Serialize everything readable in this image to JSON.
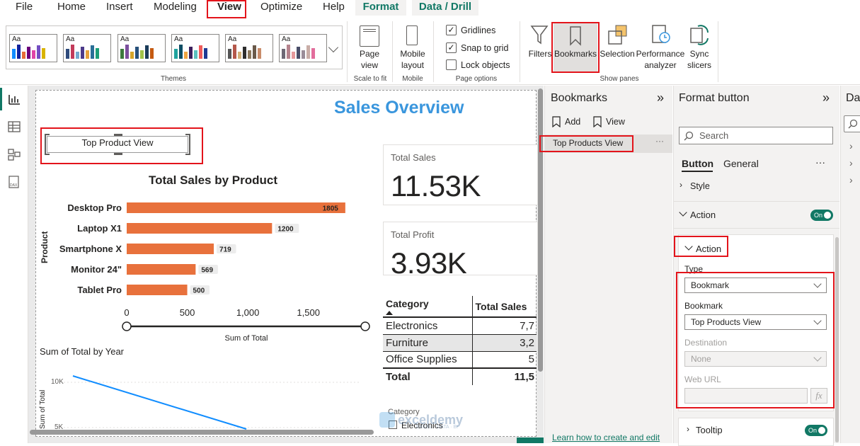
{
  "menu": {
    "items": [
      "File",
      "Home",
      "Insert",
      "Modeling",
      "View",
      "Optimize",
      "Help"
    ],
    "contextual": [
      "Format",
      "Data / Drill"
    ],
    "active": "View"
  },
  "ribbon": {
    "themes_label": "Themes",
    "page_view": {
      "label1": "Page",
      "label2": "view",
      "group": "Scale to fit"
    },
    "mobile": {
      "label1": "Mobile",
      "label2": "layout",
      "group": "Mobile"
    },
    "page_options": {
      "gridlines": "Gridlines",
      "snap": "Snap to grid",
      "lock": "Lock objects",
      "group": "Page options",
      "gridlines_checked": true,
      "snap_checked": true,
      "lock_checked": false
    },
    "show_panes": {
      "filters": "Filters",
      "bookmarks": "Bookmarks",
      "selection": "Selection",
      "perf1": "Performance",
      "perf2": "analyzer",
      "sync1": "Sync",
      "sync2": "slicers",
      "group": "Show panes"
    }
  },
  "report": {
    "title": "Sales Overview",
    "button_text": "Top Product View",
    "bar_chart": {
      "title": "Total Sales by Product",
      "ylabel": "Product",
      "xlabel": "Sum of Total",
      "xticks": [
        "0",
        "500",
        "1,000",
        "1,500"
      ]
    },
    "cards": [
      {
        "label": "Total Sales",
        "value": "11.53K"
      },
      {
        "label": "Total Profit",
        "value": "3.93K"
      }
    ],
    "matrix": {
      "headers": [
        "Category",
        "Total Sales"
      ],
      "rows": [
        {
          "cat": "Electronics",
          "val": "7,7"
        },
        {
          "cat": "Furniture",
          "val": "3,2"
        },
        {
          "cat": "Office Supplies",
          "val": "5"
        }
      ],
      "total_label": "Total",
      "total_val": "11,5"
    },
    "line_chart": {
      "title": "Sum of Total by Year",
      "ylabel": "Sum of Total",
      "yticks": [
        "10K",
        "5K"
      ]
    },
    "slicer": {
      "title": "Category",
      "item": "Electronics"
    },
    "watermark": {
      "name": "exceldemy",
      "tagline": "EXCEL · DATA · BI"
    }
  },
  "chart_data": {
    "type": "bar",
    "title": "Total Sales by Product",
    "categories": [
      "Desktop Pro",
      "Laptop X1",
      "Smartphone X",
      "Monitor 24\"",
      "Tablet Pro"
    ],
    "values": [
      1805,
      1200,
      719,
      569,
      500
    ],
    "xlabel": "Sum of Total",
    "ylabel": "Product",
    "xlim": [
      0,
      1800
    ]
  },
  "bookmarks_pane": {
    "title": "Bookmarks",
    "add": "Add",
    "view": "View",
    "items": [
      "Top Products View"
    ],
    "more": "···",
    "learn_link": "Learn how to create and edit"
  },
  "format_pane": {
    "title": "Format button",
    "search_placeholder": "Search",
    "tabs": [
      "Button",
      "General"
    ],
    "more": "···",
    "style": "Style",
    "action_section": "Action",
    "action_toggle": "On",
    "action_card_title": "Action",
    "type_label": "Type",
    "type_value": "Bookmark",
    "bookmark_label": "Bookmark",
    "bookmark_value": "Top Products View",
    "destination_label": "Destination",
    "destination_value": "None",
    "weburl_label": "Web URL",
    "fx": "fx",
    "tooltip": "Tooltip",
    "tooltip_toggle": "On"
  },
  "data_pane": {
    "title": "Da"
  },
  "colors": {
    "bar": "#e8713c",
    "title_blue": "#3a96dd",
    "accent": "#117865",
    "line": "#118dff",
    "highlight": "#e3141b"
  }
}
